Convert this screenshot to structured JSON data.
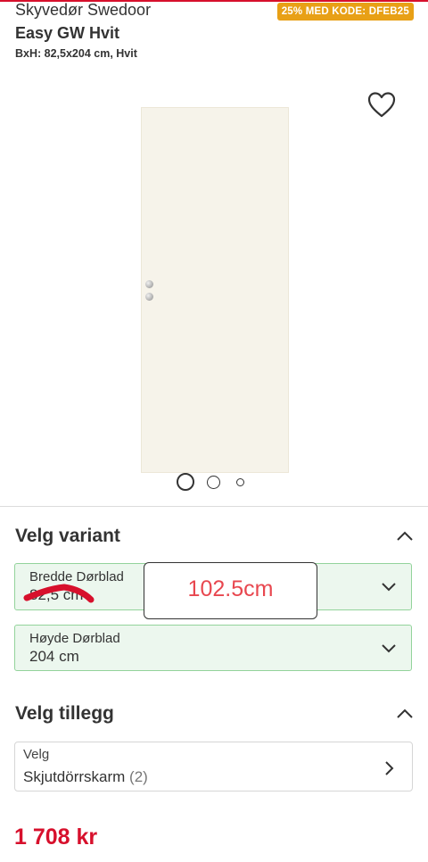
{
  "header": {
    "brand": "Skyvedør Swedoor",
    "promo_badge": "25% MED KODE: DFEB25",
    "product_name": "Easy GW Hvit",
    "dimensions": "BxH: 82,5x204 cm, Hvit"
  },
  "gallery": {
    "slide_count": 3,
    "active_index": 0
  },
  "variant_section": {
    "title": "Velg variant",
    "width_label": "Bredde Dørblad",
    "width_value": "82,5 cm",
    "height_label": "Høyde Dørblad",
    "height_value": "204 cm"
  },
  "addon_section": {
    "title": "Velg tillegg",
    "select_label": "Velg",
    "select_value": "Skjutdörrskarm",
    "select_count": "(2)"
  },
  "annotation": {
    "text": "102.5cm",
    "color": "#e8474f"
  },
  "price": "1 708 kr",
  "colors": {
    "brand_red": "#d7102c",
    "promo_orange": "#e8a016",
    "select_green_border": "#93d39b",
    "select_green_bg": "#ecf7ee"
  }
}
